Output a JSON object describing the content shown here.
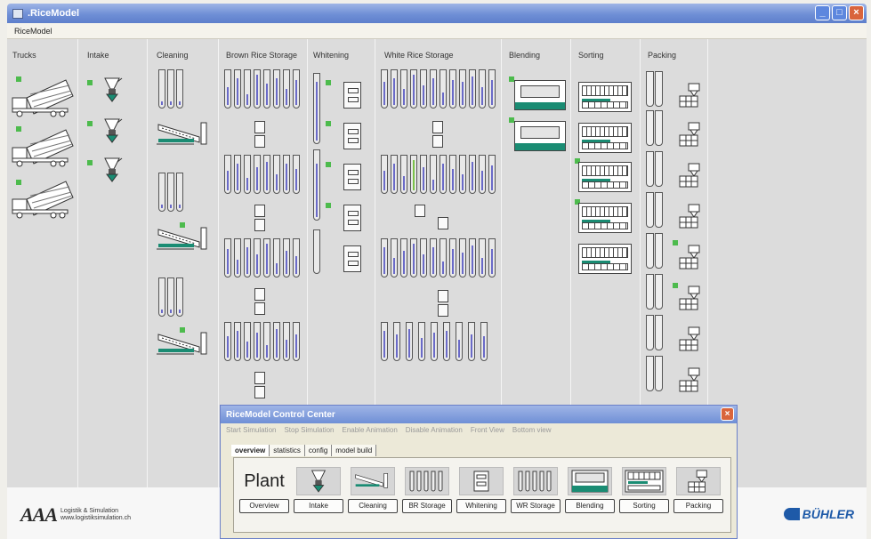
{
  "window": {
    "title": ".RiceModel"
  },
  "menu": {
    "items": [
      "RiceModel"
    ]
  },
  "columns": [
    "Trucks",
    "Intake",
    "Cleaning",
    "Brown Rice Storage",
    "Whitening",
    "White Rice Storage",
    "Blending",
    "Sorting",
    "Packing"
  ],
  "footer": {
    "aaa_mark": "AAA",
    "aaa_line1": "Logistik & Simulation",
    "aaa_line2": "www.logistiksimulation.ch",
    "buhler": "BÜHLER"
  },
  "dialog": {
    "title": "RiceModel Control Center",
    "menu": [
      "Start Simulation",
      "Stop Simulation",
      "Enable Animation",
      "Disable Animation",
      "Front View",
      "Bottom view"
    ],
    "tabs": [
      "overview",
      "statistics",
      "config",
      "model build"
    ],
    "plant_label": "Plant",
    "buttons": [
      "Overview",
      "Intake",
      "Cleaning",
      "BR Storage",
      "Whitening",
      "WR Storage",
      "Blending",
      "Sorting",
      "Packing"
    ]
  },
  "colors": {
    "status_green": "#4dbb4d",
    "teal": "#1a8c73",
    "title_blue": "#6f8fd6",
    "buhler_blue": "#1e5aa8"
  }
}
